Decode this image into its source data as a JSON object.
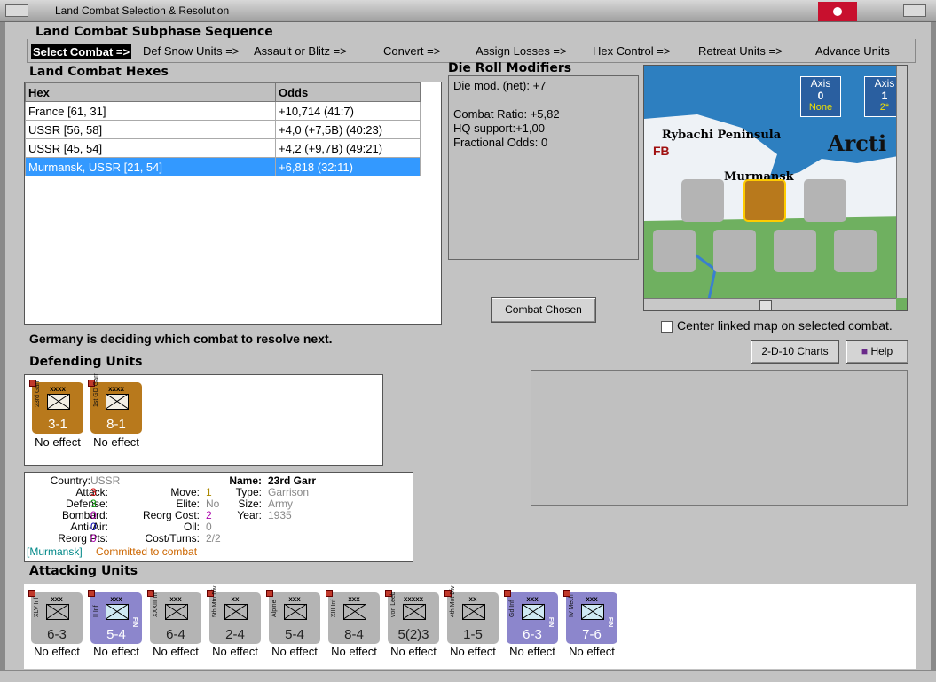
{
  "window": {
    "title": "Land Combat Selection & Resolution"
  },
  "sequence": {
    "title": "Land Combat Subphase Sequence",
    "steps": [
      "Select Combat =>",
      "Def Snow Units =>",
      "Assault or Blitz =>",
      "Convert =>",
      "Assign Losses =>",
      "Hex Control =>",
      "Retreat Units =>",
      "Advance Units"
    ]
  },
  "hexes": {
    "title": "Land Combat Hexes",
    "columns": [
      "Hex",
      "Odds"
    ],
    "rows": [
      {
        "hex": "France [61, 31]",
        "odds": "+10,714 (41:7)"
      },
      {
        "hex": "USSR [56, 58]",
        "odds": "+4,0 (+7,5B) (40:23)"
      },
      {
        "hex": "USSR [45, 54]",
        "odds": "+4,2 (+9,7B) (49:21)"
      },
      {
        "hex": "Murmansk, USSR [21, 54]",
        "odds": "+6,818 (32:11)"
      }
    ]
  },
  "modifiers": {
    "title": "Die Roll Modifiers",
    "lines": [
      "Die mod. (net): +7",
      "",
      "Combat Ratio: +5,82",
      "HQ support:+1,00",
      "Fractional Odds: 0"
    ]
  },
  "buttons": {
    "combat_chosen": "Combat Chosen",
    "charts": "2-D-10 Charts",
    "help": "Help"
  },
  "map": {
    "labels": {
      "peninsula": "Rybachi Peninsula",
      "arctic": "Arcti",
      "murmansk": "Murmansk",
      "fb": "FB"
    },
    "axis_boxes": [
      {
        "title": "Axis",
        "value": "0",
        "sub": "None"
      },
      {
        "title": "Axis",
        "value": "1",
        "sub": "2*"
      }
    ],
    "colors": {
      "sea": "#2d7fc0",
      "land": "#eef2f6",
      "forest": "#6fb060"
    }
  },
  "center_checkbox": {
    "label": "Center linked map on selected combat.",
    "checked": false
  },
  "status": "Germany is deciding which combat to resolve next.",
  "defending": {
    "title": "Defending Units",
    "units": [
      {
        "size": "xxxx",
        "name": "23rd Garr",
        "strength": "3-1",
        "effect": "No effect"
      },
      {
        "size": "xxxx",
        "name": "1st GD Garr",
        "strength": "8-1",
        "effect": "No effect"
      }
    ]
  },
  "info": {
    "country_label": "Country:",
    "country": "USSR",
    "attack_label": "Attack:",
    "attack": "3",
    "defense_label": "Defense:",
    "defense": "3",
    "bombard_label": "Bombard:",
    "bombard": "0",
    "antiair_label": "Anti-Air:",
    "antiair": "0",
    "reorgpts_label": "Reorg Pts:",
    "reorgpts": "0",
    "move_label": "Move:",
    "move": "1",
    "elite_label": "Elite:",
    "elite": "No",
    "reorgcost_label": "Reorg Cost:",
    "reorgcost": "2",
    "oil_label": "Oil:",
    "oil": "0",
    "costturns_label": "Cost/Turns:",
    "costturns": "2/2",
    "name_label": "Name:",
    "name": "23rd Garr",
    "type_label": "Type:",
    "type": "Garrison",
    "size_label": "Size:",
    "size": "Army",
    "year_label": "Year:",
    "year": "1935",
    "location": "[Murmansk]",
    "committed": "Committed to combat"
  },
  "attacking": {
    "title": "Attacking Units",
    "units": [
      {
        "size": "xxx",
        "name": "XLV Inf",
        "strength": "6-3",
        "effect": "No effect",
        "nat": ""
      },
      {
        "size": "xxx",
        "name": "II Inf",
        "strength": "5-4",
        "effect": "No effect",
        "nat": "FIN"
      },
      {
        "size": "xxx",
        "name": "XXXIII Inf",
        "strength": "6-4",
        "effect": "No effect",
        "nat": ""
      },
      {
        "size": "xx",
        "name": "5th Mtn Div",
        "strength": "2-4",
        "effect": "No effect",
        "nat": ""
      },
      {
        "size": "xxx",
        "name": "Alpine",
        "strength": "5-4",
        "effect": "No effect",
        "nat": ""
      },
      {
        "size": "xxx",
        "name": "XIII Inf",
        "strength": "8-4",
        "effect": "No effect",
        "nat": ""
      },
      {
        "size": "xxxxx",
        "name": "von Leeb",
        "strength": "5(2)3",
        "effect": "No effect",
        "nat": ""
      },
      {
        "size": "xx",
        "name": "4th Mot Div",
        "strength": "1-5",
        "effect": "No effect",
        "nat": ""
      },
      {
        "size": "xxx",
        "name": "Gd Inf",
        "strength": "6-3",
        "effect": "No effect",
        "nat": "FIN"
      },
      {
        "size": "xxx",
        "name": "IV Mech",
        "strength": "7-6",
        "effect": "No effect",
        "nat": "FIN"
      }
    ]
  }
}
